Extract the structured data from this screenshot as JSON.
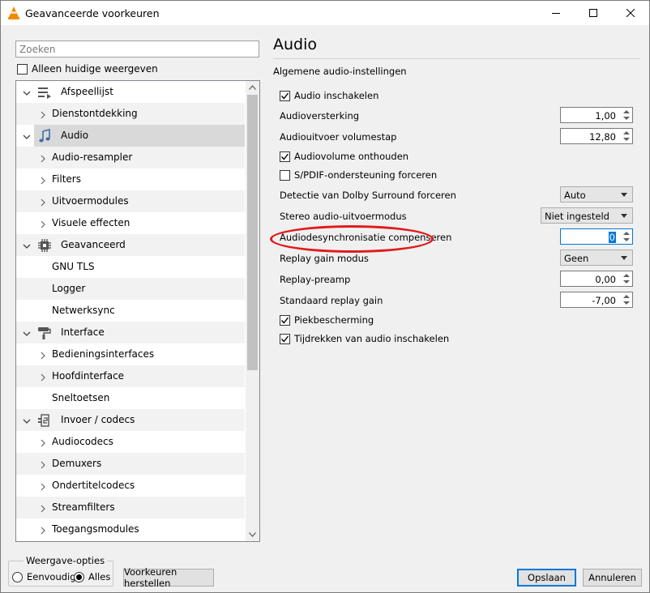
{
  "window": {
    "title": "Geavanceerde voorkeuren"
  },
  "sidebar": {
    "search_placeholder": "Zoeken",
    "only_current_label": "Alleen huidige weergeven",
    "tree": [
      {
        "label": "Afspeellijst",
        "level": 0,
        "expanded": true,
        "icon": "playlist-icon"
      },
      {
        "label": "Dienstontdekking",
        "level": 1,
        "arrow": true
      },
      {
        "label": "Audio",
        "level": 0,
        "expanded": true,
        "icon": "music-note-icon",
        "selected": true
      },
      {
        "label": "Audio-resampler",
        "level": 1,
        "arrow": true
      },
      {
        "label": "Filters",
        "level": 1,
        "arrow": true
      },
      {
        "label": "Uitvoermodules",
        "level": 1,
        "arrow": true
      },
      {
        "label": "Visuele effecten",
        "level": 1,
        "arrow": true
      },
      {
        "label": "Geavanceerd",
        "level": 0,
        "expanded": true,
        "icon": "chip-icon"
      },
      {
        "label": "GNU TLS",
        "level": 1,
        "arrow": false
      },
      {
        "label": "Logger",
        "level": 1,
        "arrow": false
      },
      {
        "label": "Netwerksync",
        "level": 1,
        "arrow": false
      },
      {
        "label": "Interface",
        "level": 0,
        "expanded": true,
        "icon": "paint-roller-icon"
      },
      {
        "label": "Bedieningsinterfaces",
        "level": 1,
        "arrow": true
      },
      {
        "label": "Hoofdinterface",
        "level": 1,
        "arrow": true
      },
      {
        "label": "Sneltoetsen",
        "level": 1,
        "arrow": false
      },
      {
        "label": "Invoer / codecs",
        "level": 0,
        "expanded": true,
        "icon": "codec-icon"
      },
      {
        "label": "Audiocodecs",
        "level": 1,
        "arrow": true
      },
      {
        "label": "Demuxers",
        "level": 1,
        "arrow": true
      },
      {
        "label": "Ondertitelcodecs",
        "level": 1,
        "arrow": true
      },
      {
        "label": "Streamfilters",
        "level": 1,
        "arrow": true
      },
      {
        "label": "Toegangsmodules",
        "level": 1,
        "arrow": true
      }
    ]
  },
  "panel": {
    "title": "Audio",
    "subtitle": "Algemene audio-instellingen",
    "options": {
      "enable_audio": {
        "label": "Audio inschakelen",
        "checked": true
      },
      "gain": {
        "label": "Audioversterking",
        "value": "1,00"
      },
      "volume_step": {
        "label": "Audiouitvoer volumestap",
        "value": "12,80"
      },
      "remember_volume": {
        "label": "Audiovolume onthouden",
        "checked": true
      },
      "spdif": {
        "label": "S/PDIF-ondersteuning forceren",
        "checked": false
      },
      "dolby": {
        "label": "Detectie van Dolby Surround forceren",
        "value": "Auto"
      },
      "stereo_mode": {
        "label": "Stereo audio-uitvoermodus",
        "value": "Niet ingesteld"
      },
      "desync": {
        "label": "Audiodesynchronisatie compenseren",
        "value": "0"
      },
      "replay_gain_mode": {
        "label": "Replay gain modus",
        "value": "Geen"
      },
      "replay_preamp": {
        "label": "Replay-preamp",
        "value": "0,00"
      },
      "default_replay_gain": {
        "label": "Standaard replay gain",
        "value": "-7,00"
      },
      "peak_protection": {
        "label": "Piekbescherming",
        "checked": true
      },
      "time_stretch": {
        "label": "Tijdrekken van audio inschakelen",
        "checked": true
      }
    }
  },
  "footer": {
    "view_options_title": "Weergave-opties",
    "simple_label": "Eenvoudig",
    "all_label": "Alles",
    "reset_label": "Voorkeuren herstellen",
    "save_label": "Opslaan",
    "cancel_label": "Annuleren"
  },
  "colors": {
    "accent": "#0078d7",
    "highlight_ellipse": "#e01b1b",
    "selected_row": "#d9d9d9"
  }
}
